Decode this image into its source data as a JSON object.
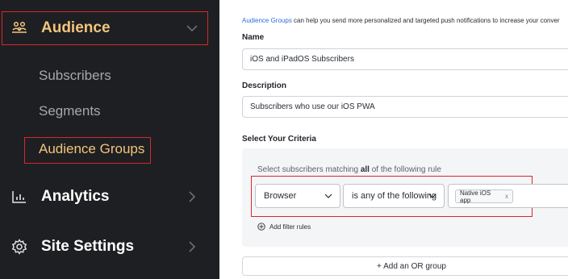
{
  "sidebar": {
    "audience": {
      "label": "Audience",
      "icon": "users-icon",
      "chevron": "chevron-down-icon"
    },
    "sub_items": [
      {
        "label": "Subscribers"
      },
      {
        "label": "Segments"
      },
      {
        "label": "Audience Groups"
      }
    ],
    "analytics": {
      "label": "Analytics",
      "icon": "bar-chart-icon",
      "chevron": "chevron-right-icon"
    },
    "site_settings": {
      "label": "Site Settings",
      "icon": "gear-icon",
      "chevron": "chevron-right-icon"
    }
  },
  "main": {
    "intro_link": "Audience Groups",
    "intro_text": " can help you send more personalized and targeted push notifications to increase your conver",
    "name_label": "Name",
    "name_value": "iOS and iPadOS Subscribers",
    "description_label": "Description",
    "description_value": "Subscribers who use our iOS PWA",
    "criteria_label": "Select Your Criteria",
    "rule_prefix": "Select subscribers matching ",
    "rule_bold": "all",
    "rule_suffix": " of the following rule",
    "field_select": "Browser",
    "operator_select": "is any of the following",
    "tag_value": "Native iOS app",
    "tag_remove": "x",
    "add_filter": "Add filter rules",
    "add_or_group": "+ Add an OR group"
  },
  "colors": {
    "sidebar_bg": "#1e1f22",
    "highlight_text": "#f2c57c",
    "highlight_border": "#d9262c",
    "link_blue": "#2f6fd6"
  }
}
